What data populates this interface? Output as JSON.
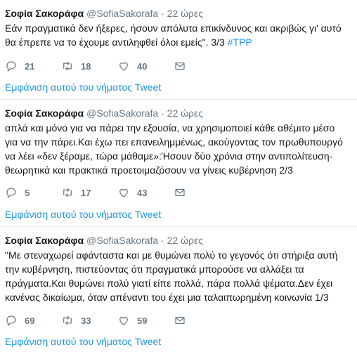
{
  "tweets": [
    {
      "name": "Σοφία Σακοράφα",
      "handle": "@SofiaSakorafa",
      "dot": "·",
      "time": "22 ώρες",
      "lines": [
        "Εάν πραγματικά δεν ήξερες, ήσουν απόλυτα επικίνδυνος και ακριβώς γι' αυτό",
        "θα έπρεπε να το έχουμε αντιληφθεί όλοι εμείς\". 3/3 "
      ],
      "hashtag": "#TPP",
      "replies": "21",
      "retweets": "18",
      "likes": "40",
      "thread_link": "Εμφάνιση αυτού του νήματος Tweet"
    },
    {
      "name": "Σοφία Σακοράφα",
      "handle": "@SofiaSakorafa",
      "dot": "·",
      "time": "22 ώρες",
      "lines": [
        "απλά και μόνο για να πάρει την εξουσία, να χρησιμοποιεί κάθε αθέμιτο μέσο",
        "για να την πάρει.Και έχω πει επανειλημμένως, ακούγοντας τον πρωθυπουργό",
        "να λέει «δεν ξέραμε, τώρα μάθαμε»:Ήσουν δύο χρόνια στην αντιπολίτευση-",
        "θεωρητικά και πρακτικά προετοιμαζόσουν να γίνεις κυβέρνηση 2/3"
      ],
      "hashtag": "",
      "replies": "5",
      "retweets": "17",
      "likes": "43",
      "thread_link": "Εμφάνιση αυτού του νήματος Tweet"
    },
    {
      "name": "Σοφία Σακοράφα",
      "handle": "@SofiaSakorafa",
      "dot": "·",
      "time": "22 ώρες",
      "lines": [
        "\"Με στεναχωρεί αφάνταστα και με θυμώνει πολύ το γεγονός ότι στήριξα αυτή",
        "την κυβέρνηση, πιστεύοντας ότι πραγματικά μπορούσε να αλλάξει τα",
        "πράγματα.Και θυμώνει πολύ γιατί είπε πολλά, πάρα πολλά ψέματα.Δεν έχει",
        "κανένας δικαίωμα, όταν απέναντι του έχει μια ταλαιπωρημένη κοινωνία 1/3"
      ],
      "hashtag": "",
      "replies": "69",
      "retweets": "33",
      "likes": "59",
      "thread_link": "Εμφάνιση αυτού του νήματος Tweet"
    }
  ],
  "colors": {
    "link": "#1b95e0",
    "muted": "#657786",
    "text": "#14171a",
    "separator": "#e6ecf0"
  },
  "icons": [
    "reply-icon",
    "retweet-icon",
    "like-icon",
    "direct-message-icon"
  ]
}
